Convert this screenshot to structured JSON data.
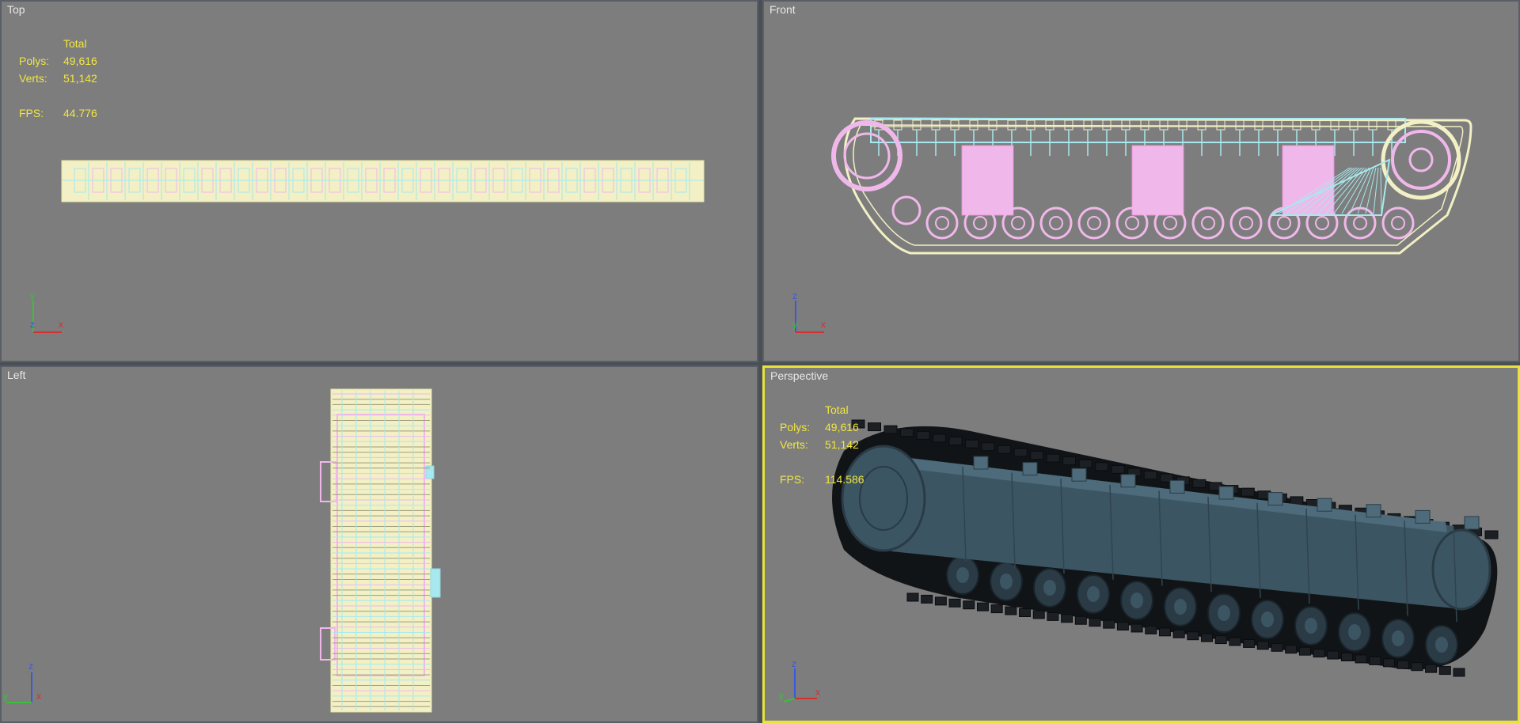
{
  "viewports": {
    "top": {
      "label": "Top",
      "axes": {
        "up": "y",
        "depth": "z",
        "right": "x"
      }
    },
    "front": {
      "label": "Front",
      "axes": {
        "up": "z",
        "depth": "y",
        "right": "x"
      }
    },
    "left": {
      "label": "Left",
      "axes": {
        "up": "z",
        "depth": "x",
        "right": "y"
      }
    },
    "perspective": {
      "label": "Perspective",
      "axes": {
        "up": "z",
        "depth": "y",
        "right": "x"
      },
      "active": true
    }
  },
  "stats_top": {
    "header": "Total",
    "polys_label": "Polys:",
    "polys_value": "49,616",
    "verts_label": "Verts:",
    "verts_value": "51,142",
    "fps_label": "FPS:",
    "fps_value": "44.776"
  },
  "stats_perspective": {
    "header": "Total",
    "polys_label": "Polys:",
    "polys_value": "49,616",
    "verts_label": "Verts:",
    "verts_value": "51,142",
    "fps_label": "FPS:",
    "fps_value": "114.586"
  },
  "colors": {
    "viewport_bg": "#7d7d7d",
    "active_border": "#e9e43a",
    "stats_text": "#f2e640",
    "wire_yellow": "#f2f0c4",
    "wire_cyan": "#a7e9ee",
    "wire_pink": "#f0b8ea",
    "shaded_hull": "#3c5563",
    "axis_x": "#d43030",
    "axis_y": "#38c038",
    "axis_z": "#3858e0"
  }
}
